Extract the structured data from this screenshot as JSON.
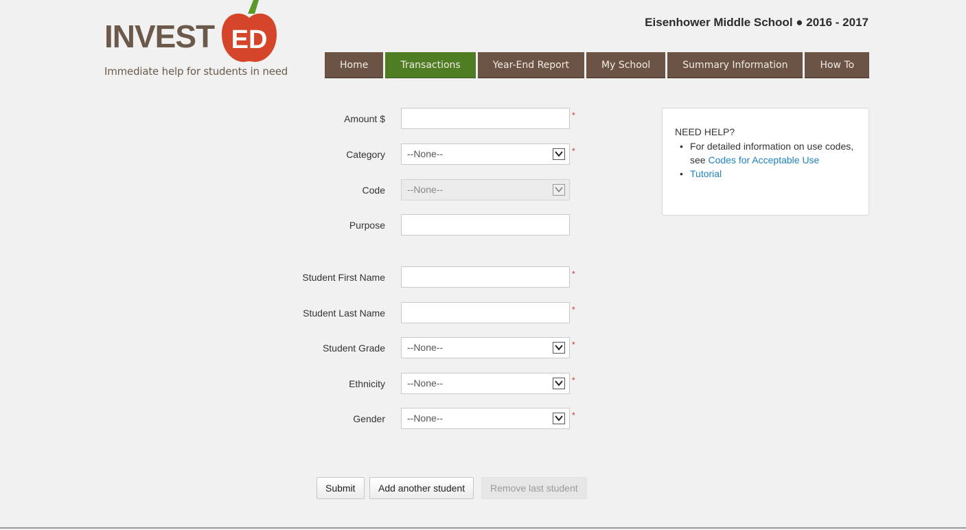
{
  "logo": {
    "word": "INVEST",
    "badge": "ED",
    "tagline": "Immediate help for students in need"
  },
  "school_info": "Eisenhower Middle School ● 2016 - 2017",
  "nav": [
    {
      "label": "Home",
      "active": false
    },
    {
      "label": "Transactions",
      "active": true
    },
    {
      "label": "Year-End Report",
      "active": false
    },
    {
      "label": "My School",
      "active": false
    },
    {
      "label": "Summary Information",
      "active": false
    },
    {
      "label": "How To",
      "active": false
    }
  ],
  "form": {
    "amount": {
      "label": "Amount $",
      "value": "",
      "required_mark": "*"
    },
    "category": {
      "label": "Category",
      "value": "--None--",
      "required_mark": "*"
    },
    "code": {
      "label": "Code",
      "value": "--None--"
    },
    "purpose": {
      "label": "Purpose",
      "value": ""
    },
    "first_name": {
      "label": "Student First Name",
      "value": "",
      "required_mark": "*"
    },
    "last_name": {
      "label": "Student Last Name",
      "value": "",
      "required_mark": "*"
    },
    "grade": {
      "label": "Student Grade",
      "value": "--None--",
      "required_mark": "*"
    },
    "ethnicity": {
      "label": "Ethnicity",
      "value": "--None--",
      "required_mark": "*"
    },
    "gender": {
      "label": "Gender",
      "value": "--None--",
      "required_mark": "*"
    }
  },
  "help": {
    "title": "NEED HELP?",
    "item1_text": "For detailed information on use codes, see ",
    "item1_link": "Codes for Acceptable Use",
    "item2_link": "Tutorial",
    "bullet": "•"
  },
  "buttons": {
    "submit": "Submit",
    "add_student": "Add another student",
    "remove_student": "Remove last student"
  },
  "colors": {
    "nav_brown": "#6b5446",
    "nav_active_green": "#4f7d23",
    "logo_brown": "#6b5a4b",
    "apple_red": "#d5452a",
    "leaf_green": "#5a9a2a",
    "link_blue": "#1f82c0",
    "required_red": "#cc3333"
  }
}
